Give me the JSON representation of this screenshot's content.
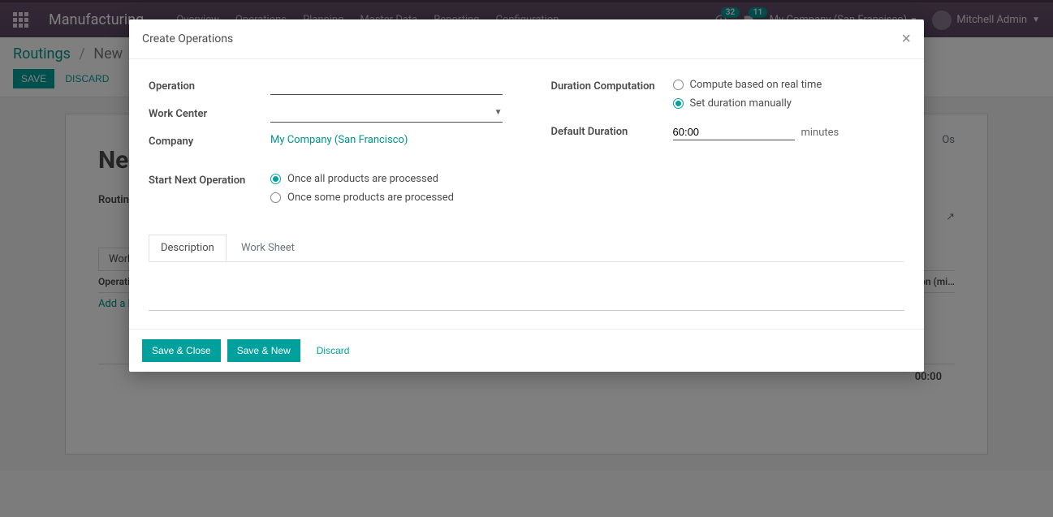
{
  "navbar": {
    "brand": "Manufacturing",
    "menu": [
      "Overview",
      "Operations",
      "Planning",
      "Master Data",
      "Reporting",
      "Configuration"
    ],
    "activity_badge": "32",
    "discuss_badge": "11",
    "company": "My Company (San Francisco)",
    "user": "Mitchell Admin"
  },
  "breadcrumb": {
    "root": "Routings",
    "current": "New"
  },
  "cp": {
    "save": "Save",
    "discard": "Discard"
  },
  "sheet": {
    "wos_label": "Os",
    "title": "New",
    "routing_label": "Routing",
    "ext_link_icon": "external-link",
    "tab_wc": "Work C",
    "col_op": "Operati",
    "col_dur": "on (mi…",
    "add_line": "Add a li",
    "total": "00:00"
  },
  "modal": {
    "title": "Create Operations",
    "labels": {
      "operation": "Operation",
      "work_center": "Work Center",
      "company": "Company",
      "start_next": "Start Next Operation",
      "duration_comp": "Duration Computation",
      "default_duration": "Default Duration"
    },
    "company_value": "My Company (San Francisco)",
    "start_options": {
      "all": "Once all products are processed",
      "some": "Once some products are processed"
    },
    "duration_options": {
      "real": "Compute based on real time",
      "manual": "Set duration manually"
    },
    "duration_value": "60:00",
    "duration_unit": "minutes",
    "tabs": {
      "description": "Description",
      "worksheet": "Work Sheet"
    },
    "buttons": {
      "save_close": "Save & Close",
      "save_new": "Save & New",
      "discard": "Discard"
    }
  }
}
